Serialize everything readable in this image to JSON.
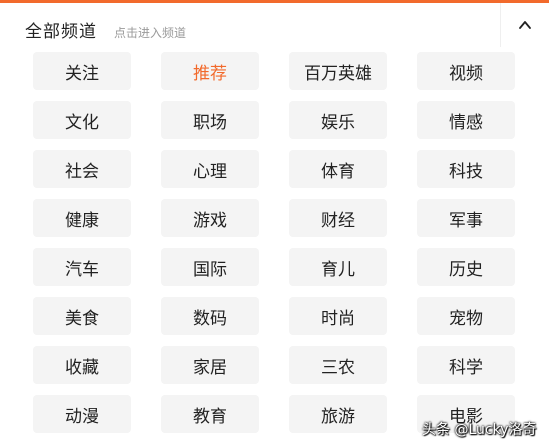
{
  "header": {
    "title": "全部频道",
    "hint": "点击进入频道"
  },
  "channels": [
    "关注",
    "推荐",
    "百万英雄",
    "视频",
    "文化",
    "职场",
    "娱乐",
    "情感",
    "社会",
    "心理",
    "体育",
    "科技",
    "健康",
    "游戏",
    "财经",
    "军事",
    "汽车",
    "国际",
    "育儿",
    "历史",
    "美食",
    "数码",
    "时尚",
    "宠物",
    "收藏",
    "家居",
    "三农",
    "科学",
    "动漫",
    "教育",
    "旅游",
    "电影"
  ],
  "active_channel": "推荐",
  "watermark": "头条 @Lucky洛奇",
  "colors": {
    "accent": "#f26a2c",
    "chip_bg": "#f4f4f4"
  }
}
